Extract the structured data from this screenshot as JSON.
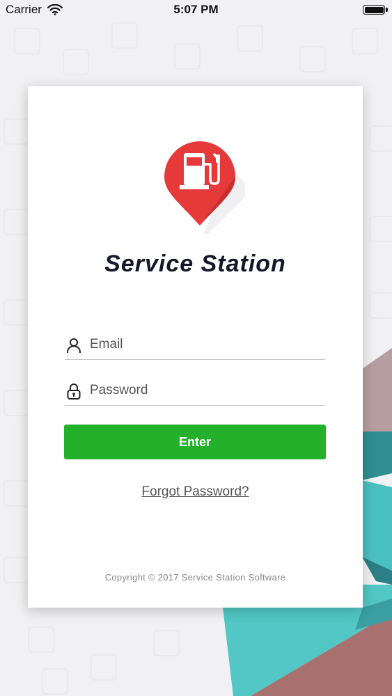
{
  "status_bar": {
    "carrier": "Carrier",
    "time": "5:07 PM"
  },
  "login": {
    "app_title": "Service Station",
    "email_placeholder": "Email",
    "password_placeholder": "Password",
    "enter_label": "Enter",
    "forgot_label": "Forgot Password?",
    "copyright": "Copyright © 2017 Service Station Software"
  },
  "icons": {
    "logo": "fuel-pump-pin-icon",
    "email": "user-icon",
    "password": "lock-icon"
  },
  "colors": {
    "accent_green": "#23b12b",
    "logo_red": "#e63a3a",
    "title_dark": "#16172a"
  }
}
